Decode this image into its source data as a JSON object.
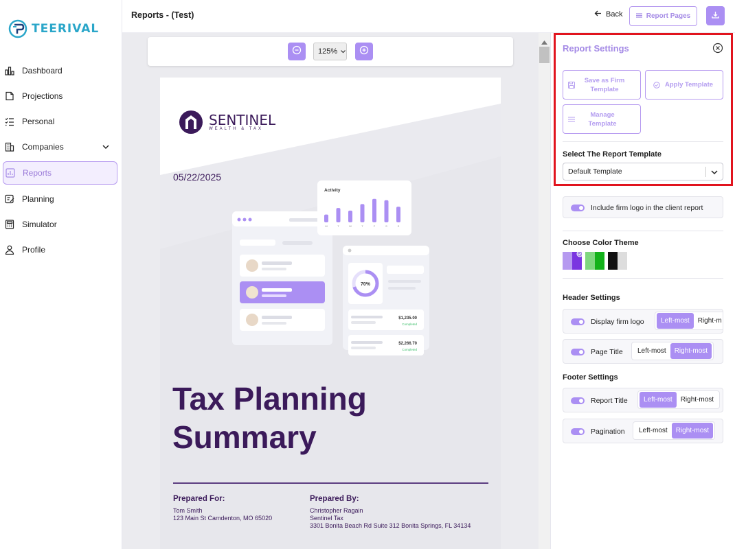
{
  "app": {
    "brand": "TEERIVAL"
  },
  "sidebar": {
    "items": [
      {
        "label": "Dashboard",
        "icon": "chart-bar-icon"
      },
      {
        "label": "Projections",
        "icon": "document-icon"
      },
      {
        "label": "Personal",
        "icon": "checklist-icon"
      },
      {
        "label": "Companies",
        "icon": "building-icon"
      },
      {
        "label": "Reports",
        "icon": "report-chart-icon",
        "active": true
      },
      {
        "label": "Planning",
        "icon": "planning-icon"
      },
      {
        "label": "Simulator",
        "icon": "calculator-icon"
      },
      {
        "label": "Profile",
        "icon": "person-icon"
      }
    ]
  },
  "header": {
    "title": "Reports - (Test)",
    "back_label": "Back",
    "report_pages_label": "Report Pages"
  },
  "preview": {
    "zoom": "125%",
    "firm_name": "SENTINEL",
    "firm_tagline": "WEALTH & TAX",
    "date": "05/22/2025",
    "illustration": {
      "activity_title": "Activity",
      "activity_days": [
        "M",
        "T",
        "W",
        "T",
        "F",
        "S",
        "S"
      ],
      "activity_values": [
        0.3,
        0.55,
        0.45,
        0.7,
        0.9,
        0.85,
        0.6
      ],
      "progress_label": "70%",
      "progress_value": 0.7,
      "amount_1": "$1,235.00",
      "amount_2": "$2,266.70",
      "status": "Completed"
    },
    "title_line1": "Tax Planning",
    "title_line2": "Summary",
    "prepared_for": {
      "heading": "Prepared For:",
      "name": "Tom Smith",
      "address": "123 Main St Camdenton, MO 65020"
    },
    "prepared_by": {
      "heading": "Prepared By:",
      "name": "Christopher Ragain",
      "firm": "Sentinel Tax",
      "address": "3301 Bonita Beach Rd Suite 312 Bonita Springs, FL 34134"
    }
  },
  "settings": {
    "title": "Report Settings",
    "save_template_label": "Save as Firm Template",
    "apply_template_label": "Apply Template",
    "manage_template_label": "Manage Template",
    "template_label": "Select The Report Template",
    "template_value": "Default Template",
    "include_logo_label": "Include firm logo in the client report",
    "color_theme_label": "Choose Color Theme",
    "color_themes": [
      {
        "name": "purple",
        "colors": [
          "#b69af0",
          "#7a35e0"
        ],
        "selected": true
      },
      {
        "name": "green",
        "colors": [
          "#7fd77f",
          "#13b21a"
        ],
        "selected": false
      },
      {
        "name": "black",
        "colors": [
          "#111111",
          "#dddddd"
        ],
        "selected": false
      }
    ],
    "header_settings_label": "Header Settings",
    "footer_settings_label": "Footer Settings",
    "header_rows": [
      {
        "label": "Display firm logo",
        "left": "Left-most",
        "right": "Right-m",
        "selected": "left"
      },
      {
        "label": "Page Title",
        "left": "Left-most",
        "right": "Right-most",
        "selected": "right"
      }
    ],
    "footer_rows": [
      {
        "label": "Report Title",
        "left": "Left-most",
        "right": "Right-most",
        "selected": "left"
      },
      {
        "label": "Pagination",
        "left": "Left-most",
        "right": "Right-most",
        "selected": "right"
      }
    ]
  },
  "colors": {
    "accent": "#ab8ff3",
    "brand_dark": "#3b1a5a",
    "highlight": "#e1141e"
  }
}
